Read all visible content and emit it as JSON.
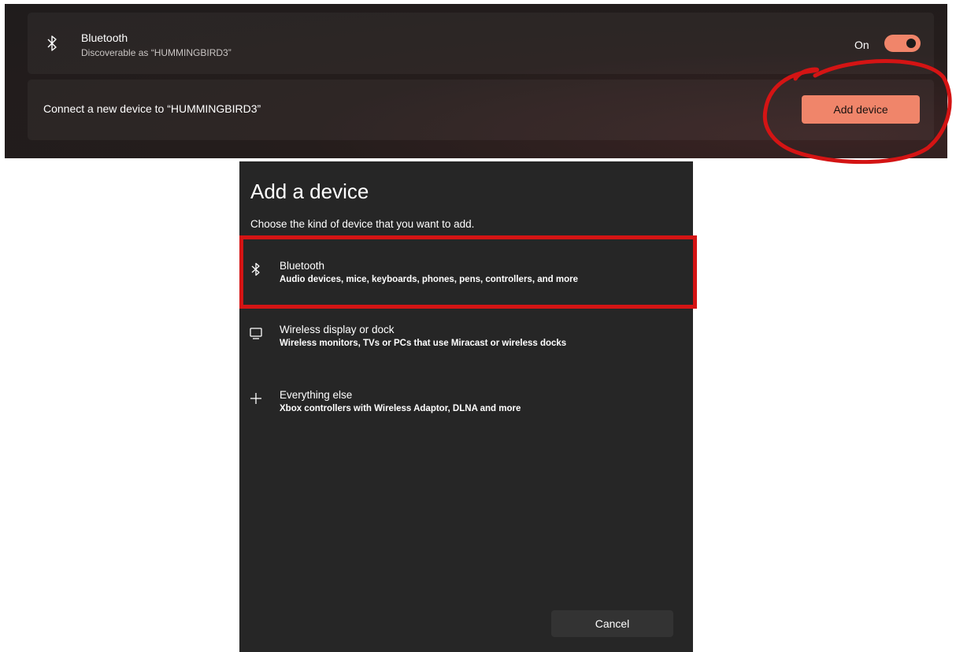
{
  "settings": {
    "bluetooth": {
      "icon": "bluetooth-icon",
      "title": "Bluetooth",
      "subtitle": "Discoverable as “HUMMINGBIRD3”",
      "toggle_label": "On",
      "toggle_on": true
    },
    "connect": {
      "text": "Connect a new device to “HUMMINGBIRD3”",
      "button_label": "Add device"
    },
    "accent_color": "#f0856a",
    "annotation_color": "#d41414"
  },
  "dialog": {
    "title": "Add a device",
    "subtitle": "Choose the kind of device that you want to add.",
    "options": [
      {
        "icon": "bluetooth-icon",
        "title": "Bluetooth",
        "description": "Audio devices, mice, keyboards, phones, pens, controllers, and more"
      },
      {
        "icon": "monitor-icon",
        "title": "Wireless display or dock",
        "description": "Wireless monitors, TVs or PCs that use Miracast or wireless docks"
      },
      {
        "icon": "plus-icon",
        "title": "Everything else",
        "description": "Xbox controllers with Wireless Adaptor, DLNA and more"
      }
    ],
    "cancel_label": "Cancel"
  }
}
